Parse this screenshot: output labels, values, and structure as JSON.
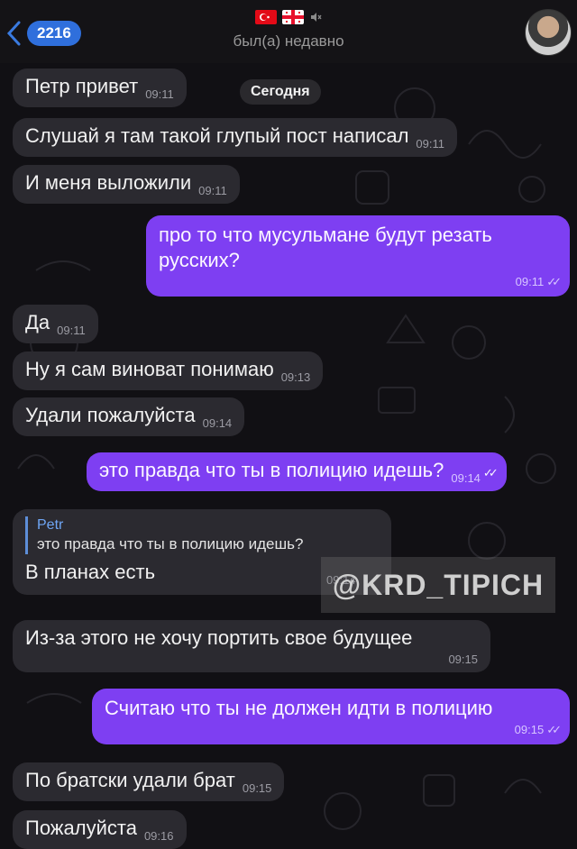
{
  "header": {
    "back_count": "2216",
    "status": "был(а) недавно"
  },
  "date_separator": "Сегодня",
  "messages": [
    {
      "text": "Петр привет",
      "time": "09:11"
    },
    {
      "text": "Слушай я там такой глупый пост написал",
      "time": "09:11"
    },
    {
      "text": "И меня выложили",
      "time": "09:11"
    },
    {
      "text": "про то что мусульмане будут резать русских?",
      "time": "09:11",
      "ticks": "✓✓"
    },
    {
      "text": "Да",
      "time": "09:11"
    },
    {
      "text": "Ну я сам виноват понимаю",
      "time": "09:13"
    },
    {
      "text": "Удали пожалуйста",
      "time": "09:14"
    },
    {
      "text": "это правда что ты в полицию идешь?",
      "time": "09:14",
      "ticks": "✓✓"
    },
    {
      "reply_name": "Petr",
      "reply_text": "это правда что ты в полицию идешь?",
      "text": "В планах есть",
      "time": "09:14"
    },
    {
      "text": "Из-за этого не хочу портить свое будущее",
      "time": "09:15"
    },
    {
      "text": "Считаю что ты не должен идти в полицию",
      "time": "09:15",
      "ticks": "✓✓"
    },
    {
      "text": "По братски удали брат",
      "time": "09:15"
    },
    {
      "text": "Пожалуйста",
      "time": "09:16"
    }
  ],
  "watermark": "@KRD_TIPICH",
  "colors": {
    "background": "#111014",
    "incoming_bubble": "#2b2a30",
    "outgoing_bubble": "#7e3ff2",
    "badge": "#2f6fdc"
  },
  "icons": [
    "chevron-left-icon",
    "turkey-flag-icon",
    "georgia-flag-icon",
    "mute-icon",
    "read-ticks-icon"
  ]
}
